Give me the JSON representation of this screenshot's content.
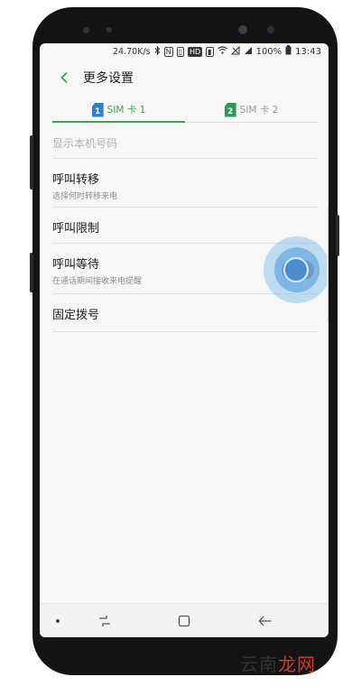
{
  "status_bar": {
    "speed": "24.70K/s",
    "hd_badge": "HD",
    "battery": "100%",
    "time": "13:43",
    "icons": [
      "bluetooth-icon",
      "nfc-icon",
      "vibrate-icon",
      "hd-icon",
      "wifi-icon",
      "no-signal-icon",
      "signal-icon",
      "battery-icon"
    ]
  },
  "header": {
    "title": "更多设置",
    "back_icon": "chevron-left-icon"
  },
  "tabs": [
    {
      "number": "1",
      "label": "SIM 卡 1",
      "active": true,
      "color": "#2f7fcf"
    },
    {
      "number": "2",
      "label": "SIM 卡 2",
      "active": false,
      "color": "#2f9a57"
    }
  ],
  "settings": {
    "show_number": {
      "title": "显示本机号码"
    },
    "call_forwarding": {
      "title": "呼叫转移",
      "subtitle": "选择何时转移来电"
    },
    "call_barring": {
      "title": "呼叫限制"
    },
    "call_waiting": {
      "title": "呼叫等待",
      "subtitle": "在通话期间接收来电提醒",
      "enabled": true
    },
    "fixed_dialing": {
      "title": "固定拨号"
    }
  },
  "navbar": {
    "icons": [
      "dot-icon",
      "recent-apps-icon",
      "home-icon",
      "back-icon"
    ]
  },
  "watermark": {
    "text_a": "云南",
    "text_b": "龙网"
  },
  "colors": {
    "accent": "#3ea34a",
    "toggle": "#4b8bd0"
  }
}
